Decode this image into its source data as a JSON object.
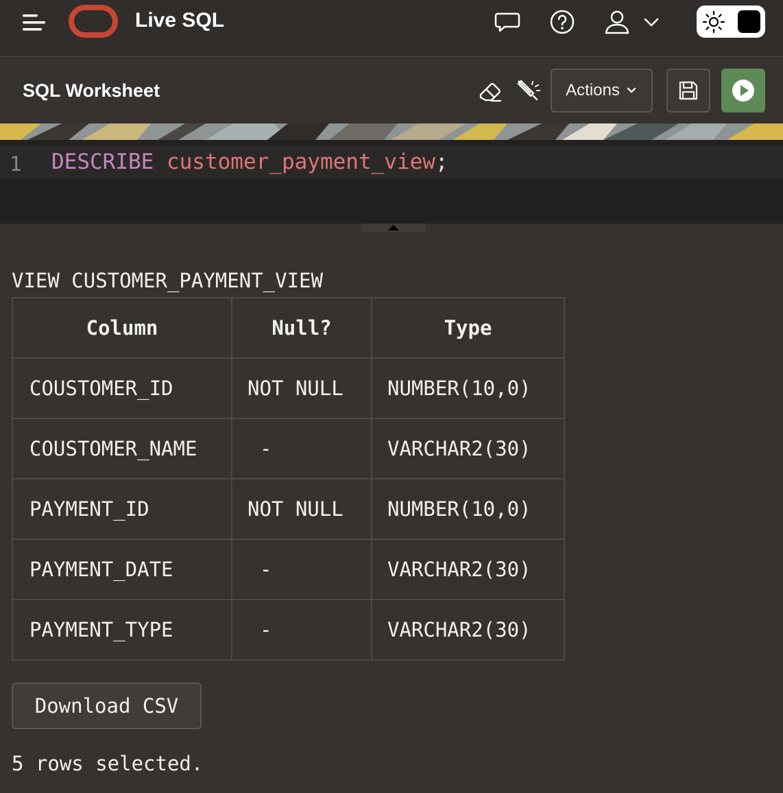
{
  "header": {
    "app_title": "Live SQL",
    "icons": [
      "menu-icon",
      "oracle-logo",
      "feedback-icon",
      "help-icon",
      "user-icon",
      "chevron-down-icon",
      "sun-icon"
    ]
  },
  "worksheet": {
    "title": "SQL Worksheet",
    "actions_label": "Actions",
    "icons": [
      "eraser-icon",
      "format-icon",
      "save-icon",
      "run-icon"
    ]
  },
  "editor": {
    "line_number": "1",
    "keyword": "DESCRIBE",
    "identifier": "customer_payment_view",
    "terminator": ";"
  },
  "output": {
    "title": "VIEW CUSTOMER_PAYMENT_VIEW",
    "columns": [
      "Column",
      "Null?",
      "Type"
    ],
    "rows": [
      [
        "COUSTOMER_ID",
        "NOT NULL",
        "NUMBER(10,0)"
      ],
      [
        "COUSTOMER_NAME",
        "-",
        "VARCHAR2(30)"
      ],
      [
        "PAYMENT_ID",
        "NOT NULL",
        "NUMBER(10,0)"
      ],
      [
        "PAYMENT_DATE",
        "-",
        "VARCHAR2(30)"
      ],
      [
        "PAYMENT_TYPE",
        "-",
        "VARCHAR2(30)"
      ]
    ],
    "download_label": "Download CSV",
    "status": "5 rows selected."
  },
  "colors": {
    "run_green": "#5e8a57",
    "oracle_red": "#c74634",
    "keyword": "#c586c0",
    "identifier": "#e07575"
  }
}
